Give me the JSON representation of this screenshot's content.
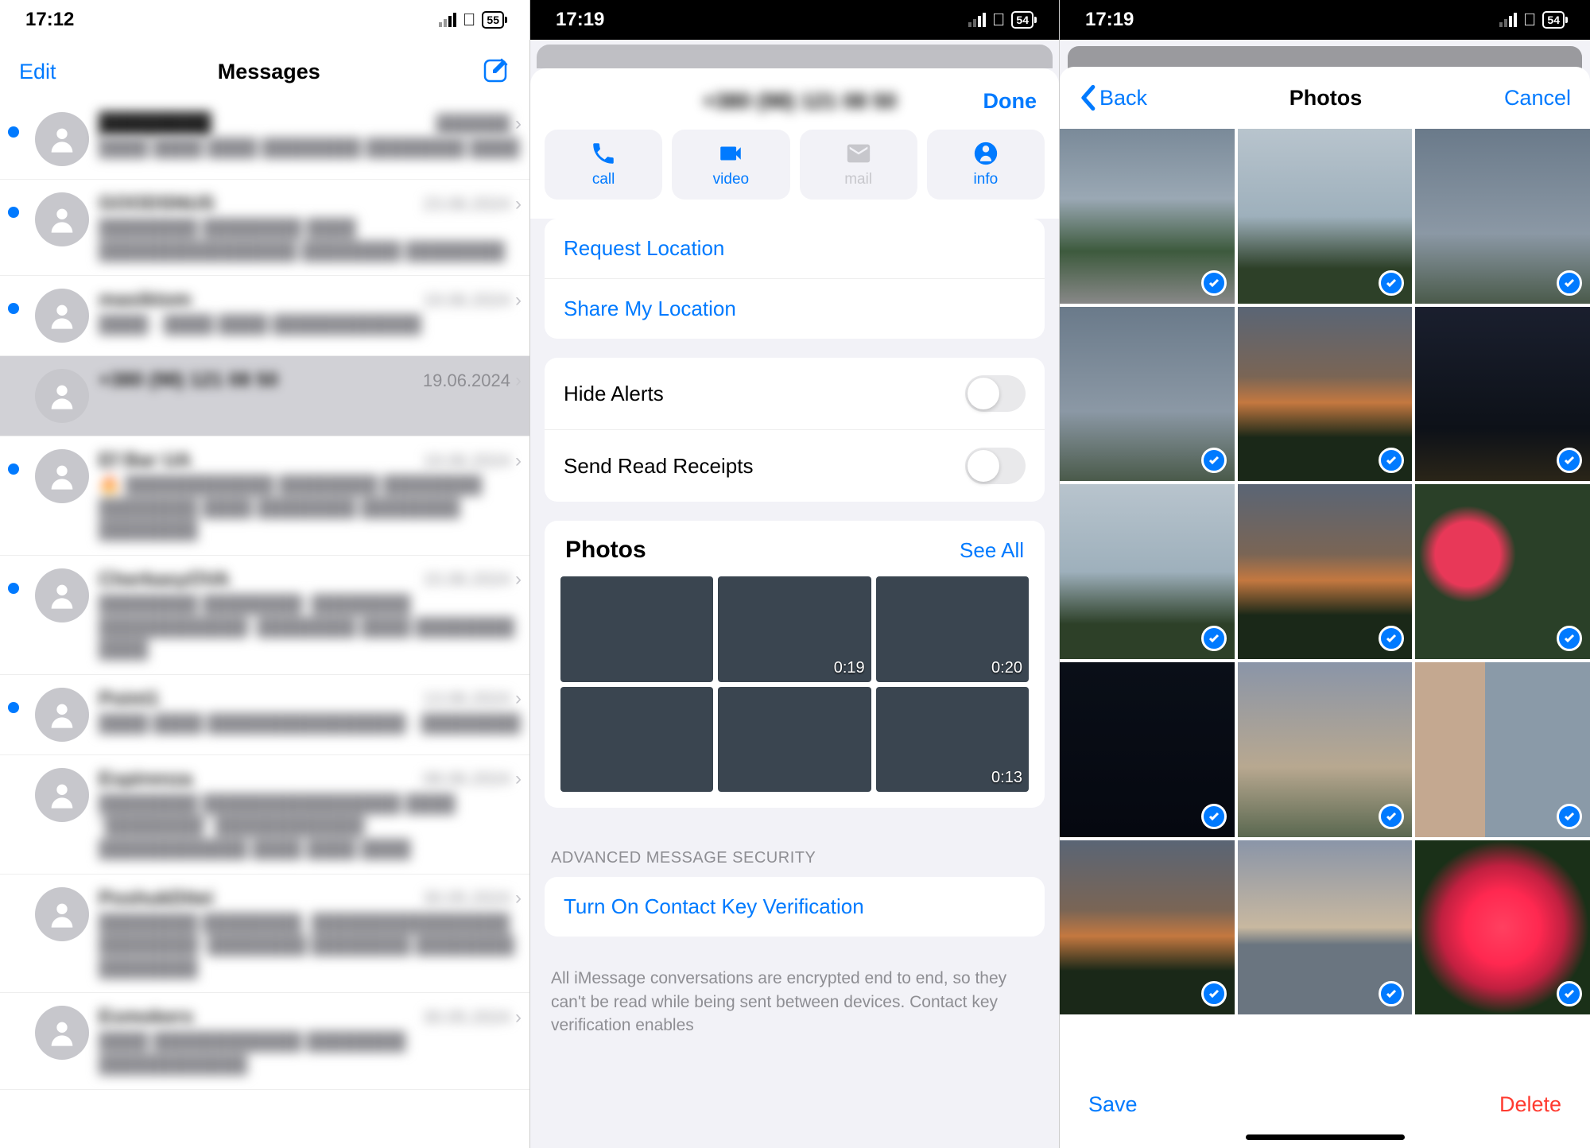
{
  "s1": {
    "time": "17:12",
    "battery": "55",
    "edit": "Edit",
    "title": "Messages",
    "rows": [
      {
        "unread": true,
        "name": "████████",
        "date": "██████",
        "preview": "████ ████ ████ ████████ ████████ ████"
      },
      {
        "unread": true,
        "name": "GOODSNUS",
        "date": "23.06.2024",
        "preview": "████████ ████████ ████ ████████████████ ████████ ████████"
      },
      {
        "unread": true,
        "name": "masiktom",
        "date": "19.06.2024",
        "preview": "████ - ████ ████ ████████████"
      },
      {
        "unread": false,
        "name": "+380 (98) 121 08 50",
        "date": "19.06.2024",
        "preview": "",
        "selected": true,
        "date_clear": true
      },
      {
        "unread": true,
        "name": "Ef Bar UA",
        "date": "19.06.2024",
        "preview": "🔥 ████████████ ████████ ████████ ████████ ████ ████████ ████████ ████████"
      },
      {
        "unread": true,
        "name": "CherkasyOVA",
        "date": "15.06.2024",
        "preview": "████████ ████████! ████████ ████████████! ████████ ████ ████████ ████"
      },
      {
        "unread": true,
        "name": "Point1",
        "date": "13.06.2024",
        "preview": "████ ████ ████████████████ - ████████"
      },
      {
        "unread": false,
        "name": "Espirenza",
        "date": "08.06.2024",
        "preview": "████████ ████████████████ ████ \"████████\" ████████████! ████████████ ████ ████ ████"
      },
      {
        "unread": false,
        "name": "PoshukDitei",
        "date": "30.05.2024",
        "preview": "████████ ████████, ████████████████ ████████! ████████ ████████ ████████ ████████"
      },
      {
        "unread": false,
        "name": "Esmokers",
        "date": "30.05.2024",
        "preview": "████ ████████████ ████████ ████████████"
      }
    ]
  },
  "s2": {
    "time": "17:19",
    "battery": "54",
    "phone": "+380 (98) 121 08 50",
    "done": "Done",
    "actions": {
      "call": "call",
      "video": "video",
      "mail": "mail",
      "info": "info"
    },
    "request_location": "Request Location",
    "share_location": "Share My Location",
    "hide_alerts": "Hide Alerts",
    "read_receipts": "Send Read Receipts",
    "photos_title": "Photos",
    "see_all": "See All",
    "thumbs": [
      {
        "cls": "laptop"
      },
      {
        "cls": "dark",
        "dur": "0:19"
      },
      {
        "cls": "sunset",
        "dur": "0:20"
      },
      {
        "cls": "sky1"
      },
      {
        "cls": "building"
      },
      {
        "cls": "sky3",
        "dur": "0:13"
      }
    ],
    "security_head": "ADVANCED MESSAGE SECURITY",
    "verify": "Turn On Contact Key Verification",
    "security_text": "All iMessage conversations are encrypted end to end, so they can't be read while being sent between devices. Contact key verification enables"
  },
  "s3": {
    "time": "17:19",
    "battery": "54",
    "back": "Back",
    "title": "Photos",
    "cancel": "Cancel",
    "thumbs": [
      {
        "cls": "sky1"
      },
      {
        "cls": "sky2"
      },
      {
        "cls": "sky3"
      },
      {
        "cls": "sky3"
      },
      {
        "cls": "sunset"
      },
      {
        "cls": "night"
      },
      {
        "cls": "sky2"
      },
      {
        "cls": "sunset"
      },
      {
        "cls": "flowers"
      },
      {
        "cls": "dark"
      },
      {
        "cls": "dusk"
      },
      {
        "cls": "building"
      },
      {
        "cls": "sunset"
      },
      {
        "cls": "person"
      },
      {
        "cls": "roses"
      }
    ],
    "save": "Save",
    "delete": "Delete"
  }
}
